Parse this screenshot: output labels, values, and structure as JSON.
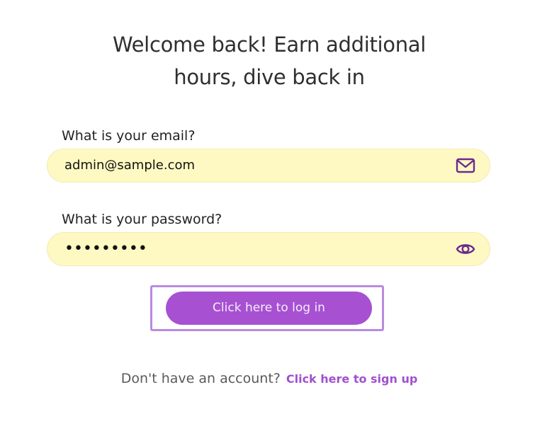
{
  "heading": {
    "line1": "Welcome back! Earn additional",
    "line2": "hours, dive back in"
  },
  "email": {
    "label": "What is your email?",
    "value": "admin@sample.com",
    "icon": "mail-icon"
  },
  "password": {
    "label": "What is your password?",
    "value": "•••••••••",
    "icon": "eye-icon"
  },
  "login": {
    "label": "Click here to log in"
  },
  "signup": {
    "prompt": "Don't have an account?",
    "link": "Click here to sign up"
  },
  "colors": {
    "accent": "#a751d2",
    "field_bg": "#fef9c3",
    "focus_outline": "#b98be0",
    "icon": "#6b2a8f"
  }
}
